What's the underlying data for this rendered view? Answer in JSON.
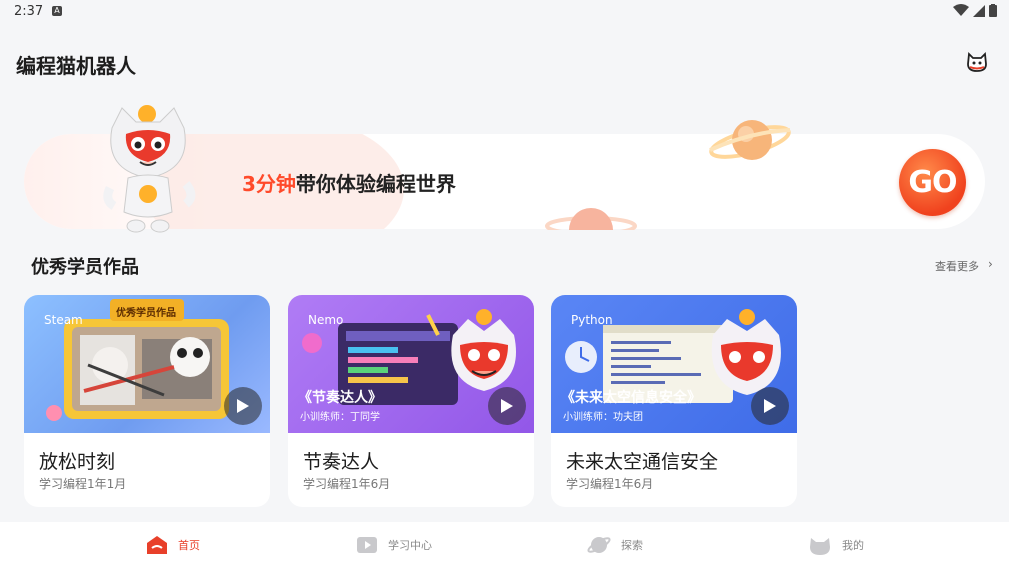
{
  "status_bar": {
    "time": "2:37",
    "notification_badge": "A"
  },
  "header": {
    "title": "编程猫机器人",
    "mascot_icon": "cat-face-icon"
  },
  "banner": {
    "highlight": "3分钟",
    "text": "带你体验编程世界",
    "go_label": "GO"
  },
  "section": {
    "title": "优秀学员作品",
    "see_more": "查看更多",
    "chevron": "›"
  },
  "cards": [
    {
      "title": "放松时刻",
      "meta": "学习编程1年1月",
      "tag": "Steam",
      "caption": "",
      "sub": "",
      "header_badge": "优秀学员作品"
    },
    {
      "title": "节奏达人",
      "meta": "学习编程1年6月",
      "tag": "Nemo",
      "caption": "《节奏达人》",
      "sub": "小训练师：丁同学"
    },
    {
      "title": "未来太空通信安全",
      "meta": "学习编程1年6月",
      "tag": "Python",
      "caption": "《未来太空信息安全》",
      "sub": "小训练师：功夫团"
    }
  ],
  "bottom_nav": [
    {
      "label": "首页",
      "icon": "home-icon",
      "active": true
    },
    {
      "label": "学习中心",
      "icon": "video-icon",
      "active": false
    },
    {
      "label": "探索",
      "icon": "planet-icon",
      "active": false
    },
    {
      "label": "我的",
      "icon": "profile-icon",
      "active": false
    }
  ],
  "colors": {
    "accent": "#e8402a",
    "background": "#f5f6f8",
    "card1_bg": "#7fb3f5",
    "card2_bg": "#a36cf0",
    "card3_bg": "#4f7bf0"
  }
}
